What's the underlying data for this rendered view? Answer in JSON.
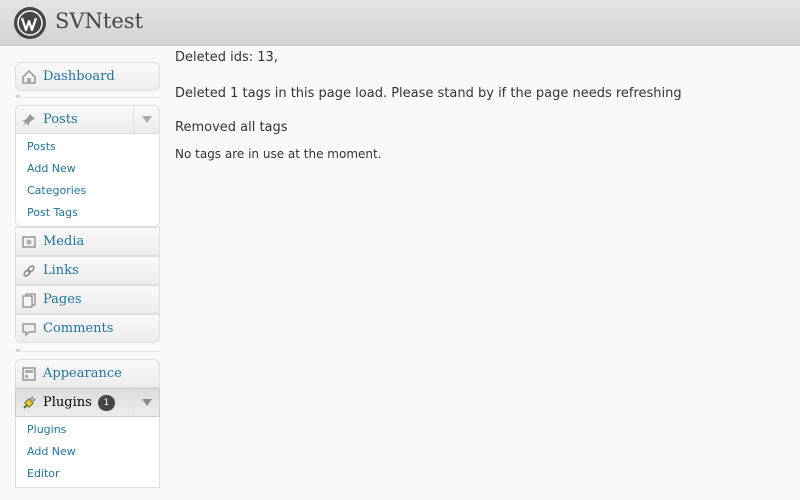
{
  "header": {
    "site_title": "SVNtest",
    "logo_icon": "wordpress-logo-icon"
  },
  "sidebar": {
    "dashboard": {
      "label": "Dashboard",
      "icon": "dashboard-icon"
    },
    "collapse_glyph": "«",
    "posts": {
      "label": "Posts",
      "icon": "pushpin-icon",
      "items": [
        "Posts",
        "Add New",
        "Categories",
        "Post Tags"
      ]
    },
    "media": {
      "label": "Media",
      "icon": "media-icon"
    },
    "links": {
      "label": "Links",
      "icon": "link-icon"
    },
    "pages": {
      "label": "Pages",
      "icon": "pages-icon"
    },
    "comments": {
      "label": "Comments",
      "icon": "comment-icon"
    },
    "appearance": {
      "label": "Appearance",
      "icon": "appearance-icon"
    },
    "plugins": {
      "label": "Plugins",
      "icon": "plug-icon",
      "badge": "1",
      "items": [
        "Plugins",
        "Add New",
        "Editor"
      ]
    }
  },
  "content": {
    "deleted_ids": "Deleted ids: 13,",
    "deleted_tags": "Deleted 1 tags in this page load. Please stand by if the page needs refreshing",
    "removed": "Removed all tags",
    "no_tags": "No tags are in use at the moment."
  },
  "colors": {
    "link": "#21759b",
    "header_bg": "#d9d9d9",
    "badge_bg": "#464646"
  }
}
